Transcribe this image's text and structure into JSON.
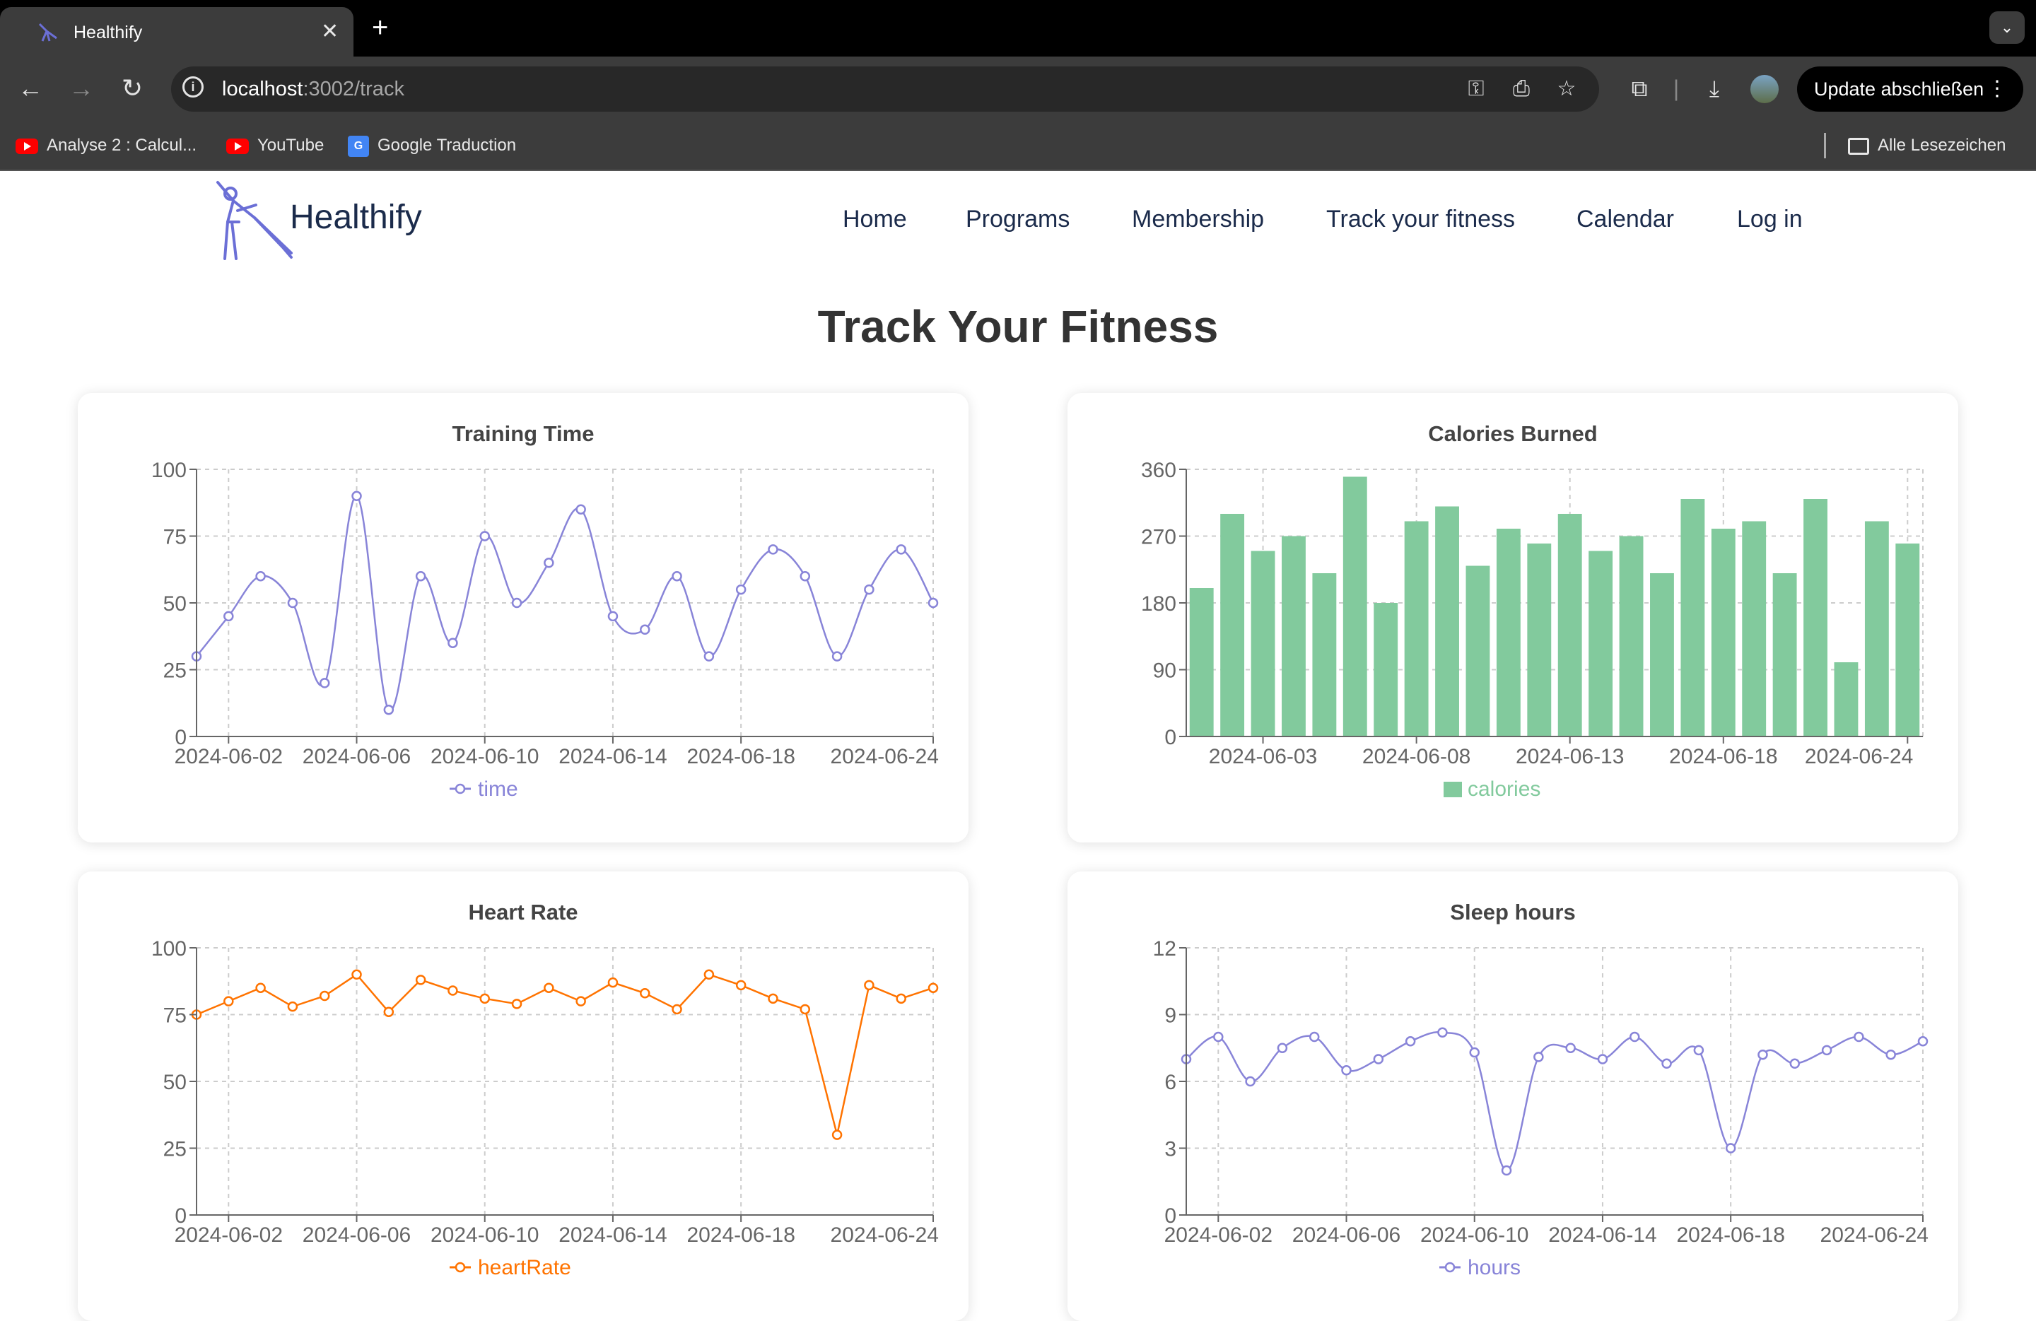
{
  "browser": {
    "tab_title": "Healthify",
    "url_host": "localhost",
    "url_path": ":3002/track",
    "update_label": "Update abschließen",
    "bookmarks": [
      {
        "label": "Analyse 2 : Calcul...",
        "icon": "youtube-icon"
      },
      {
        "label": "YouTube",
        "icon": "youtube-icon"
      },
      {
        "label": "Google Traduction",
        "icon": "google-translate-icon"
      }
    ],
    "all_bookmarks": "Alle Lesezeichen"
  },
  "site": {
    "brand": "Healthify",
    "nav": [
      "Home",
      "Programs",
      "Membership",
      "Track your fitness",
      "Calendar",
      "Log in"
    ],
    "nav_color": "#1b2b4b"
  },
  "page": {
    "title": "Track Your Fitness"
  },
  "chart_data": [
    {
      "type": "line",
      "title": "Training Time",
      "series": [
        {
          "name": "time",
          "color": "#8884d8",
          "values": [
            30,
            45,
            60,
            50,
            20,
            90,
            10,
            60,
            35,
            75,
            50,
            65,
            85,
            45,
            40,
            60,
            30,
            55,
            70,
            60,
            30,
            55,
            70,
            50
          ]
        }
      ],
      "x": [
        "2024-06-01",
        "2024-06-02",
        "2024-06-03",
        "2024-06-04",
        "2024-06-05",
        "2024-06-06",
        "2024-06-07",
        "2024-06-08",
        "2024-06-09",
        "2024-06-10",
        "2024-06-11",
        "2024-06-12",
        "2024-06-13",
        "2024-06-14",
        "2024-06-15",
        "2024-06-16",
        "2024-06-17",
        "2024-06-18",
        "2024-06-19",
        "2024-06-20",
        "2024-06-21",
        "2024-06-22",
        "2024-06-23",
        "2024-06-24"
      ],
      "xticks": [
        "2024-06-02",
        "2024-06-06",
        "2024-06-10",
        "2024-06-14",
        "2024-06-18",
        "2024-06-24"
      ],
      "yticks": [
        0,
        25,
        50,
        75,
        100
      ],
      "ylim": [
        0,
        100
      ],
      "grid": true,
      "legend": "bottom"
    },
    {
      "type": "bar",
      "title": "Calories Burned",
      "series": [
        {
          "name": "calories",
          "color": "#82ca9d",
          "values": [
            200,
            300,
            250,
            270,
            220,
            350,
            180,
            290,
            310,
            230,
            280,
            260,
            300,
            250,
            270,
            220,
            320,
            280,
            290,
            220,
            320,
            100,
            290,
            260
          ]
        }
      ],
      "x": [
        "2024-06-01",
        "2024-06-02",
        "2024-06-03",
        "2024-06-04",
        "2024-06-05",
        "2024-06-06",
        "2024-06-07",
        "2024-06-08",
        "2024-06-09",
        "2024-06-10",
        "2024-06-11",
        "2024-06-12",
        "2024-06-13",
        "2024-06-14",
        "2024-06-15",
        "2024-06-16",
        "2024-06-17",
        "2024-06-18",
        "2024-06-19",
        "2024-06-20",
        "2024-06-21",
        "2024-06-22",
        "2024-06-23",
        "2024-06-24"
      ],
      "xticks": [
        "2024-06-03",
        "2024-06-08",
        "2024-06-13",
        "2024-06-18",
        "2024-06-24"
      ],
      "yticks": [
        0,
        90,
        180,
        270,
        360
      ],
      "ylim": [
        0,
        360
      ],
      "grid": true,
      "legend": "bottom"
    },
    {
      "type": "line",
      "title": "Heart Rate",
      "series": [
        {
          "name": "heartRate",
          "color": "#ff7300",
          "values": [
            75,
            80,
            85,
            78,
            82,
            90,
            76,
            88,
            84,
            81,
            79,
            85,
            80,
            87,
            83,
            77,
            90,
            86,
            81,
            77,
            30,
            86,
            81,
            85
          ]
        }
      ],
      "x": [
        "2024-06-01",
        "2024-06-02",
        "2024-06-03",
        "2024-06-04",
        "2024-06-05",
        "2024-06-06",
        "2024-06-07",
        "2024-06-08",
        "2024-06-09",
        "2024-06-10",
        "2024-06-11",
        "2024-06-12",
        "2024-06-13",
        "2024-06-14",
        "2024-06-15",
        "2024-06-16",
        "2024-06-17",
        "2024-06-18",
        "2024-06-19",
        "2024-06-20",
        "2024-06-21",
        "2024-06-22",
        "2024-06-23",
        "2024-06-24"
      ],
      "xticks": [
        "2024-06-02",
        "2024-06-06",
        "2024-06-10",
        "2024-06-14",
        "2024-06-18",
        "2024-06-24"
      ],
      "yticks": [
        0,
        25,
        50,
        75,
        100
      ],
      "ylim": [
        0,
        100
      ],
      "grid": true,
      "legend": "bottom"
    },
    {
      "type": "line",
      "title": "Sleep hours",
      "series": [
        {
          "name": "hours",
          "color": "#8884d8",
          "values": [
            7,
            8,
            6,
            7.5,
            8,
            6.5,
            7,
            7.8,
            8.2,
            7.3,
            2,
            7.1,
            7.5,
            7,
            8,
            6.8,
            7.4,
            3,
            7.2,
            6.8,
            7.4,
            8,
            7.2,
            7.8
          ]
        }
      ],
      "x": [
        "2024-06-01",
        "2024-06-02",
        "2024-06-03",
        "2024-06-04",
        "2024-06-05",
        "2024-06-06",
        "2024-06-07",
        "2024-06-08",
        "2024-06-09",
        "2024-06-10",
        "2024-06-11",
        "2024-06-12",
        "2024-06-13",
        "2024-06-14",
        "2024-06-15",
        "2024-06-16",
        "2024-06-17",
        "2024-06-18",
        "2024-06-19",
        "2024-06-20",
        "2024-06-21",
        "2024-06-22",
        "2024-06-23",
        "2024-06-24"
      ],
      "xticks": [
        "2024-06-02",
        "2024-06-06",
        "2024-06-10",
        "2024-06-14",
        "2024-06-18",
        "2024-06-24"
      ],
      "yticks": [
        0,
        3,
        6,
        9,
        12
      ],
      "ylim": [
        0,
        12
      ],
      "grid": true,
      "legend": "bottom"
    }
  ]
}
